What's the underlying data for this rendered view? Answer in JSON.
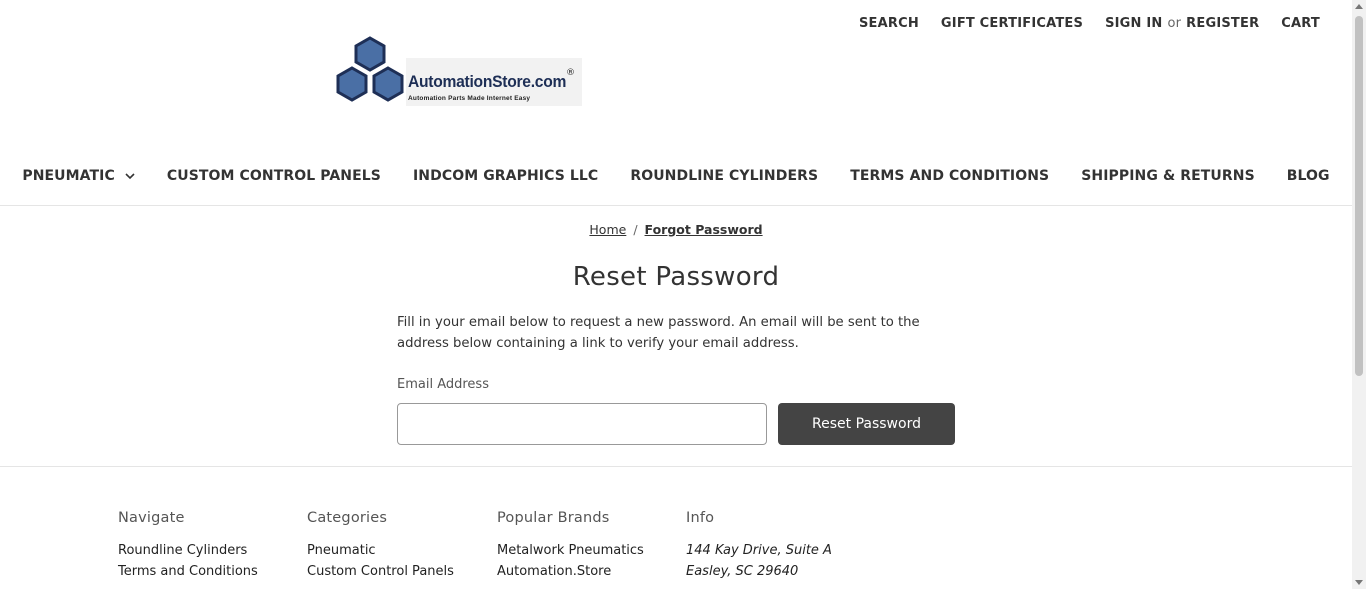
{
  "top_nav": {
    "search": "SEARCH",
    "gift_certificates": "GIFT CERTIFICATES",
    "sign_in": "SIGN IN",
    "or": "or",
    "register": "REGISTER",
    "cart": "CART"
  },
  "logo": {
    "name": "AutomationStore.com",
    "registered": "®",
    "tagline": "Automation Parts Made Internet Easy",
    "colors": {
      "hex": "#4a6fa5",
      "hex_dark": "#2c4a7a",
      "text": "#1e2f56"
    }
  },
  "main_nav": {
    "items": [
      {
        "label": "PNEUMATIC",
        "has_dropdown": true
      },
      {
        "label": "CUSTOM CONTROL PANELS"
      },
      {
        "label": "INDCOM GRAPHICS LLC"
      },
      {
        "label": "ROUNDLINE CYLINDERS"
      },
      {
        "label": "TERMS AND CONDITIONS"
      },
      {
        "label": "SHIPPING & RETURNS"
      },
      {
        "label": "BLOG"
      }
    ]
  },
  "breadcrumb": {
    "home": "Home",
    "separator": "/",
    "current": "Forgot Password"
  },
  "page": {
    "title": "Reset Password",
    "intro": "Fill in your email below to request a new password. An email will be sent to the address below containing a link to verify your email address.",
    "email_label": "Email Address",
    "email_value": "",
    "submit_label": "Reset Password"
  },
  "footer": {
    "navigate": {
      "heading": "Navigate",
      "links": [
        "Roundline Cylinders",
        "Terms and Conditions"
      ]
    },
    "categories": {
      "heading": "Categories",
      "links": [
        "Pneumatic",
        "Custom Control Panels"
      ]
    },
    "brands": {
      "heading": "Popular Brands",
      "links": [
        "Metalwork Pneumatics",
        "Automation.Store"
      ]
    },
    "info": {
      "heading": "Info",
      "address_line1": "144 Kay Drive, Suite A",
      "address_line2": "Easley, SC 29640"
    }
  }
}
